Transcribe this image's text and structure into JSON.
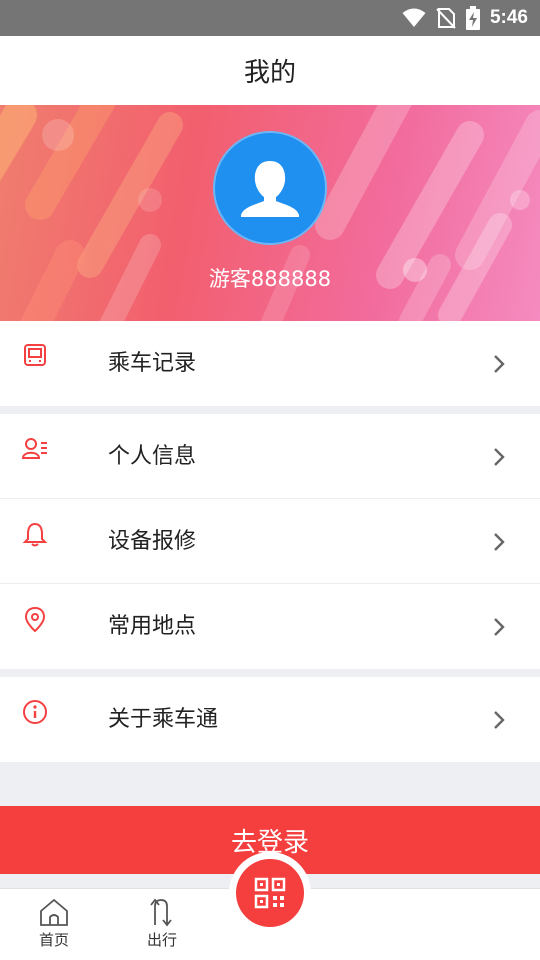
{
  "status_bar": {
    "time": "5:46"
  },
  "header": {
    "title": "我的"
  },
  "profile": {
    "username": "游客888888"
  },
  "menu_groups": [
    {
      "items": [
        {
          "label": "乘车记录",
          "icon": "bus-icon"
        }
      ]
    },
    {
      "items": [
        {
          "label": "个人信息",
          "icon": "user-info-icon"
        },
        {
          "label": "设备报修",
          "icon": "bell-icon"
        },
        {
          "label": "常用地点",
          "icon": "location-pin-icon"
        }
      ]
    },
    {
      "items": [
        {
          "label": "关于乘车通",
          "icon": "info-icon"
        }
      ]
    }
  ],
  "login_button": {
    "label": "去登录"
  },
  "bottom_nav": {
    "items": [
      {
        "label": "首页",
        "icon": "home-icon"
      },
      {
        "label": "出行",
        "icon": "route-icon"
      }
    ],
    "center_icon": "qr-code-icon"
  },
  "colors": {
    "accent": "#f53e3e",
    "avatar_bg": "#1f8ff0",
    "status_bar_bg": "#757575",
    "page_bg": "#eeeff3"
  }
}
